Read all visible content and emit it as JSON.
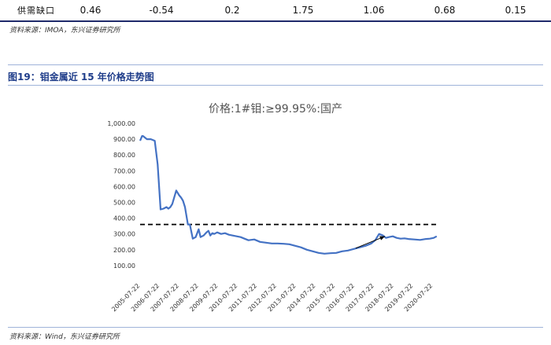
{
  "top_table": {
    "label": "供需缺口",
    "values": [
      "0.46",
      "-0.54",
      "0.2",
      "1.75",
      "1.06",
      "0.68",
      "0.15"
    ]
  },
  "source_top": "资料来源：IMOA，东兴证券研究所",
  "figure_title": "图19：钼金属近 15 年价格走势图",
  "source_bottom": "资料来源：Wind，东兴证券研究所",
  "colors": {
    "line": "#4472c4",
    "dashed": "#000000",
    "figure_title": "#1f3d8a"
  },
  "chart_data": {
    "type": "line",
    "title": "价格:1#钼:≥99.95%:国产",
    "ylim": [
      0,
      1000
    ],
    "y_ticks": [
      "1,000.00",
      "900.00",
      "800.00",
      "700.00",
      "600.00",
      "500.00",
      "400.00",
      "300.00",
      "200.00",
      "100.00"
    ],
    "x_ticks": [
      "2005-07-22",
      "2006-07-22",
      "2007-07-22",
      "2008-07-22",
      "2009-07-22",
      "2010-07-22",
      "2011-07-22",
      "2012-07-22",
      "2013-07-22",
      "2014-07-22",
      "2015-07-22",
      "2016-07-22",
      "2017-07-22",
      "2018-07-22",
      "2019-07-22",
      "2020-07-22"
    ],
    "series": [
      {
        "x": [
          2005.55,
          2005.65,
          2005.7,
          2005.9,
          2006.0,
          2006.1,
          2006.3,
          2006.45,
          2006.6,
          2006.75,
          2006.9,
          2007.0,
          2007.1,
          2007.2,
          2007.4,
          2007.55,
          2007.65,
          2007.75,
          2007.85,
          2008.0,
          2008.1,
          2008.25,
          2008.4,
          2008.55,
          2008.65,
          2008.8,
          2008.95,
          2009.05,
          2009.15,
          2009.25,
          2009.35,
          2009.5,
          2009.7,
          2009.9,
          2010.1,
          2010.3,
          2010.5,
          2010.7,
          2010.9,
          2011.1,
          2011.4,
          2011.7,
          2012.0,
          2012.3,
          2012.6,
          2012.9,
          2013.2,
          2013.5,
          2013.8,
          2014.1,
          2014.4,
          2014.7,
          2015.0,
          2015.3,
          2015.6,
          2015.9,
          2016.2,
          2016.5,
          2016.8,
          2017.1,
          2017.4,
          2017.6,
          2017.8,
          2018.0,
          2018.15,
          2018.3,
          2018.5,
          2018.7,
          2018.9,
          2019.1,
          2019.3,
          2019.6,
          2019.9,
          2020.2,
          2020.4,
          2020.6,
          2020.75
        ],
        "y": [
          890,
          920,
          920,
          900,
          900,
          900,
          890,
          740,
          455,
          460,
          470,
          460,
          470,
          490,
          575,
          545,
          530,
          510,
          470,
          360,
          360,
          270,
          280,
          330,
          280,
          290,
          310,
          320,
          290,
          305,
          300,
          310,
          300,
          305,
          295,
          290,
          285,
          280,
          270,
          260,
          265,
          250,
          245,
          240,
          240,
          238,
          235,
          225,
          215,
          200,
          190,
          180,
          175,
          178,
          180,
          190,
          195,
          205,
          215,
          225,
          240,
          260,
          300,
          290,
          275,
          280,
          285,
          275,
          270,
          272,
          268,
          265,
          262,
          268,
          270,
          275,
          285
        ]
      }
    ],
    "reference_line": 360
  }
}
